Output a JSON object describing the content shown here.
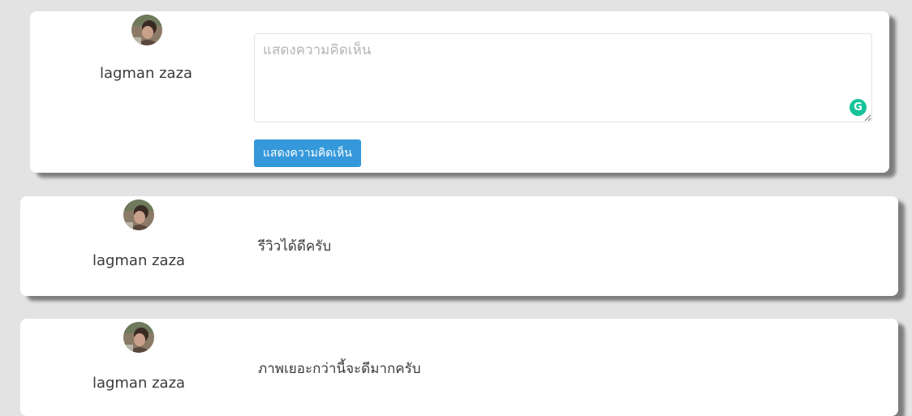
{
  "composer": {
    "username": "lagman zaza",
    "placeholder": "แสดงความคิดเห็น",
    "submit_label": "แสดงความคิดเห็น",
    "grammarly_glyph": "G",
    "grammarly_color": "#15c39a"
  },
  "comments": [
    {
      "username": "lagman zaza",
      "text": "รีวิวได้ดีครับ"
    },
    {
      "username": "lagman zaza",
      "text": "ภาพเยอะกว่านี้จะดีมากครับ"
    }
  ],
  "colors": {
    "background": "#e3e3e3",
    "card": "#ffffff",
    "button": "#3498db"
  },
  "icons": {
    "avatar": "user-avatar-photo",
    "grammarly": "grammarly-icon",
    "resize": "resize-grip-icon"
  }
}
